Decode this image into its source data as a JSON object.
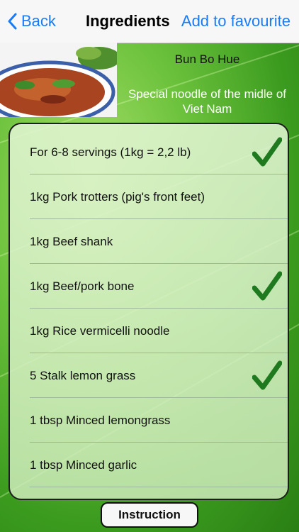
{
  "nav": {
    "back_label": "Back",
    "title": "Ingredients",
    "favourite_label": "Add to favourite"
  },
  "recipe": {
    "name": "Bun Bo Hue",
    "description": "Special noodle of the midle of Viet Nam"
  },
  "ingredients": [
    {
      "label": "For 6-8 servings (1kg = 2,2 lb)",
      "checked": true
    },
    {
      "label": "1kg Pork trotters (pig's front feet)",
      "checked": false
    },
    {
      "label": "1kg Beef shank",
      "checked": false
    },
    {
      "label": "1kg Beef/pork bone",
      "checked": true
    },
    {
      "label": "1kg Rice vermicelli noodle",
      "checked": false
    },
    {
      "label": "5 Stalk lemon grass",
      "checked": true
    },
    {
      "label": "1 tbsp Minced lemongrass",
      "checked": false
    },
    {
      "label": "1 tbsp Minced garlic",
      "checked": false
    }
  ],
  "bottom": {
    "instruction_label": "Instruction"
  },
  "colors": {
    "accent": "#1a7cf5",
    "check": "#1f7a1f"
  }
}
